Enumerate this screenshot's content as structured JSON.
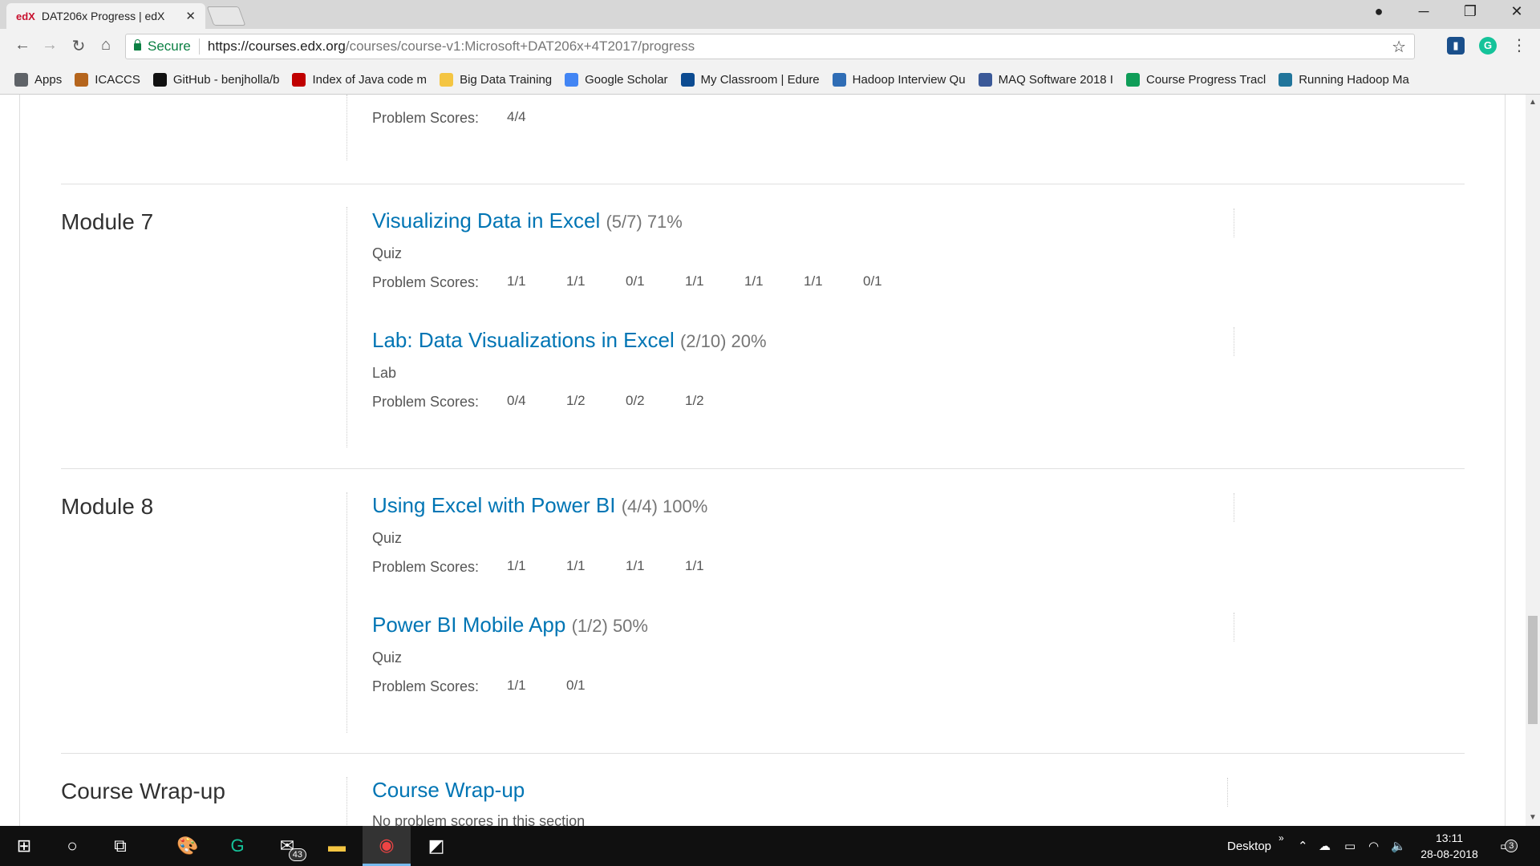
{
  "browser": {
    "tab_title": "DAT206x Progress | edX",
    "tab_favicon_text": "edX",
    "url_secure_label": "Secure",
    "url_host": "https://courses.edx.org",
    "url_path": "/courses/course-v1:Microsoft+DAT206x+4T2017/progress",
    "bookmarks": [
      {
        "label": "Apps",
        "icon": "apps-grid-icon",
        "color": "#5f6368"
      },
      {
        "label": "ICACCS",
        "icon": "icaccs-icon",
        "color": "#b5651d"
      },
      {
        "label": "GitHub - benjholla/b",
        "icon": "github-icon",
        "color": "#111111"
      },
      {
        "label": "Index of Java code m",
        "icon": "pdf-icon",
        "color": "#c00000"
      },
      {
        "label": "Big Data Training",
        "icon": "folder-icon",
        "color": "#f4c542"
      },
      {
        "label": "Google Scholar",
        "icon": "scholar-icon",
        "color": "#4285f4"
      },
      {
        "label": "My Classroom | Edure",
        "icon": "edureka-icon",
        "color": "#0c4b91"
      },
      {
        "label": "Hadoop Interview Qu",
        "icon": "hadoop-icon",
        "color": "#2f6db5"
      },
      {
        "label": "MAQ Software 2018 I",
        "icon": "facebook-icon",
        "color": "#3b5998"
      },
      {
        "label": "Course Progress Tracl",
        "icon": "sheets-icon",
        "color": "#0f9d58"
      },
      {
        "label": "Running Hadoop Ma",
        "icon": "wordpress-icon",
        "color": "#21759b"
      }
    ]
  },
  "top_partial": {
    "problem_scores_label": "Problem Scores:",
    "scores": [
      "4/4"
    ]
  },
  "modules": [
    {
      "title": "Module 7",
      "subsections": [
        {
          "title": "Visualizing Data in Excel",
          "score": "(5/7) 71%",
          "type": "Quiz",
          "problem_scores_label": "Problem Scores:",
          "scores": [
            "1/1",
            "1/1",
            "0/1",
            "1/1",
            "1/1",
            "1/1",
            "0/1"
          ]
        },
        {
          "title": "Lab: Data Visualizations in Excel",
          "score": "(2/10) 20%",
          "type": "Lab",
          "problem_scores_label": "Problem Scores:",
          "scores": [
            "0/4",
            "1/2",
            "0/2",
            "1/2"
          ]
        }
      ]
    },
    {
      "title": "Module 8",
      "subsections": [
        {
          "title": "Using Excel with Power BI",
          "score": "(4/4) 100%",
          "type": "Quiz",
          "problem_scores_label": "Problem Scores:",
          "scores": [
            "1/1",
            "1/1",
            "1/1",
            "1/1"
          ]
        },
        {
          "title": "Power BI Mobile App",
          "score": "(1/2) 50%",
          "type": "Quiz",
          "problem_scores_label": "Problem Scores:",
          "scores": [
            "1/1",
            "0/1"
          ]
        }
      ]
    },
    {
      "title": "Course Wrap-up",
      "subsections": [
        {
          "title": "Course Wrap-up",
          "no_scores_text": "No problem scores in this section"
        }
      ]
    }
  ],
  "taskbar": {
    "mail_badge": "43",
    "tray_desktop_label": "Desktop",
    "time": "13:11",
    "date": "28-08-2018",
    "notifications_count": "3"
  }
}
